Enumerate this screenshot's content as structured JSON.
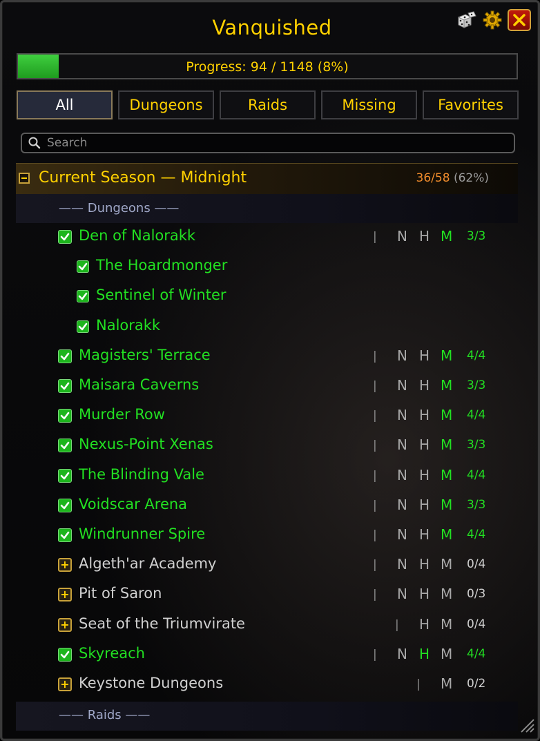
{
  "window": {
    "title": "Vanquished"
  },
  "progress": {
    "label": "Progress: 94 / 1148 (8%)",
    "fraction": 0.082
  },
  "tabs": [
    "All",
    "Dungeons",
    "Raids",
    "Missing",
    "Favorites"
  ],
  "active_tab": "All",
  "search": {
    "placeholder": "Search",
    "value": ""
  },
  "section": {
    "title": "Current Season — Midnight",
    "count": "36/58",
    "percent": "(62%)"
  },
  "subheaders": {
    "dungeons": "—— Dungeons ——",
    "raids": "—— Raids ——"
  },
  "colors": {
    "gold": "#ffd100",
    "complete": "#22e022",
    "incomplete": "#d0d0d0",
    "section_count": "#f08c2c"
  },
  "rows": [
    {
      "name": "Den of Nalorakk",
      "state": "complete",
      "difficulties": [
        "N",
        "H",
        "M"
      ],
      "done": [
        "M"
      ],
      "count": "3/3",
      "children": [
        "The Hoardmonger",
        "Sentinel of Winter",
        "Nalorakk"
      ]
    },
    {
      "name": "Magisters' Terrace",
      "state": "complete",
      "difficulties": [
        "N",
        "H",
        "M"
      ],
      "done": [
        "M"
      ],
      "count": "4/4"
    },
    {
      "name": "Maisara Caverns",
      "state": "complete",
      "difficulties": [
        "N",
        "H",
        "M"
      ],
      "done": [
        "M"
      ],
      "count": "3/3"
    },
    {
      "name": "Murder Row",
      "state": "complete",
      "difficulties": [
        "N",
        "H",
        "M"
      ],
      "done": [
        "M"
      ],
      "count": "4/4"
    },
    {
      "name": "Nexus-Point Xenas",
      "state": "complete",
      "difficulties": [
        "N",
        "H",
        "M"
      ],
      "done": [
        "M"
      ],
      "count": "3/3"
    },
    {
      "name": "The Blinding Vale",
      "state": "complete",
      "difficulties": [
        "N",
        "H",
        "M"
      ],
      "done": [
        "M"
      ],
      "count": "4/4"
    },
    {
      "name": "Voidscar Arena",
      "state": "complete",
      "difficulties": [
        "N",
        "H",
        "M"
      ],
      "done": [
        "M"
      ],
      "count": "3/3"
    },
    {
      "name": "Windrunner Spire",
      "state": "complete",
      "difficulties": [
        "N",
        "H",
        "M"
      ],
      "done": [
        "M"
      ],
      "count": "4/4"
    },
    {
      "name": "Algeth'ar Academy",
      "state": "incomplete",
      "difficulties": [
        "N",
        "H",
        "M"
      ],
      "done": [],
      "count": "0/4"
    },
    {
      "name": "Pit of Saron",
      "state": "incomplete",
      "difficulties": [
        "N",
        "H",
        "M"
      ],
      "done": [],
      "count": "0/3"
    },
    {
      "name": "Seat of the Triumvirate",
      "state": "incomplete",
      "difficulties": [
        "H",
        "M"
      ],
      "done": [],
      "count": "0/4"
    },
    {
      "name": "Skyreach",
      "state": "complete",
      "difficulties": [
        "N",
        "H",
        "M"
      ],
      "done": [
        "H"
      ],
      "count": "4/4"
    },
    {
      "name": "Keystone Dungeons",
      "state": "incomplete",
      "difficulties": [
        "M"
      ],
      "done": [],
      "count": "0/2"
    }
  ],
  "icons": {
    "dice": "dice-icon",
    "settings": "gear-icon",
    "close": "close-icon",
    "search": "search-icon",
    "collapse": "minus-icon",
    "expand": "plus-icon",
    "check": "checkbox-checked-icon"
  }
}
